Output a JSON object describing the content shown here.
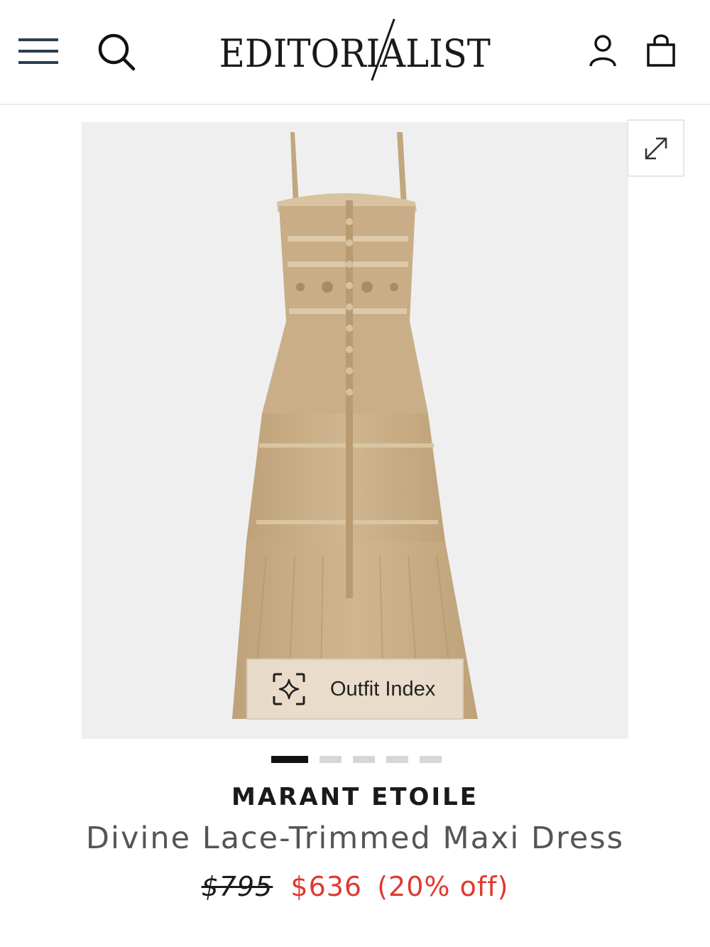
{
  "header": {
    "logo_text": "EDITORIALIST",
    "menu_icon": "hamburger-menu-icon",
    "search_icon": "search-icon",
    "account_icon": "user-icon",
    "bag_icon": "shopping-bag-icon"
  },
  "gallery": {
    "image_alt": "Divine Lace-Trimmed Maxi Dress",
    "expand_icon": "expand-icon",
    "outfit_button_label": "Outfit Index",
    "outfit_icon": "sparkle-scan-icon",
    "slide_count": 5,
    "active_slide": 1
  },
  "product": {
    "brand": "MARANT ETOILE",
    "name": "Divine Lace-Trimmed Maxi Dress",
    "original_price": "$795",
    "sale_price": "$636",
    "discount": "(20% off)"
  },
  "colors": {
    "sale": "#e0392f",
    "dress": "#c8ad86",
    "background": "#efefef"
  }
}
